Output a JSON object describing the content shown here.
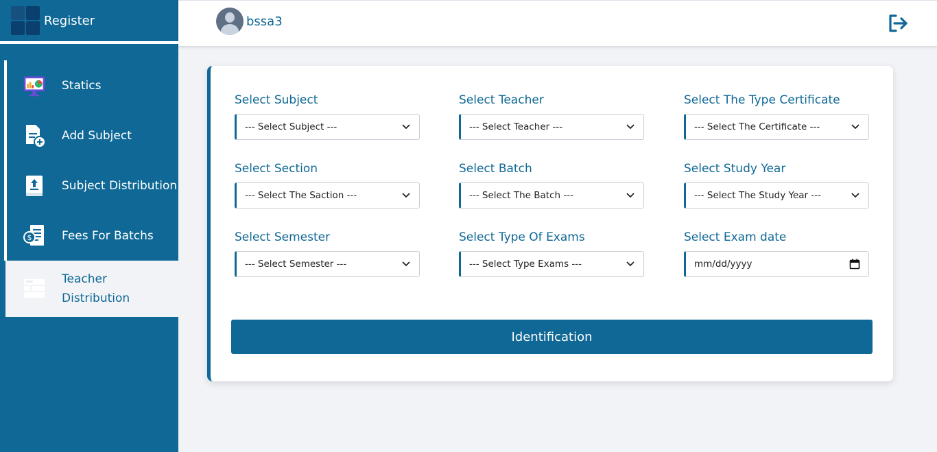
{
  "sidebar": {
    "brand": "Register",
    "items": [
      {
        "label": "Statics",
        "icon": "chart-monitor-icon"
      },
      {
        "label": "Add Subject",
        "icon": "add-document-icon"
      },
      {
        "label": "Subject Distribution",
        "icon": "upload-book-icon"
      },
      {
        "label": "Fees For Batchs",
        "icon": "fees-invoice-icon"
      },
      {
        "label": "Teacher Distribution",
        "icon": "distribution-grid-icon"
      }
    ],
    "active_index": 4
  },
  "header": {
    "username": "bssa3",
    "logout_icon": "logout-icon"
  },
  "form": {
    "subject": {
      "label": "Select Subject",
      "placeholder": "--- Select Subject ---"
    },
    "teacher": {
      "label": "Select Teacher",
      "placeholder": "--- Select Teacher ---"
    },
    "certificate": {
      "label": "Select The Type Certificate",
      "placeholder": "--- Select The Certificate ---"
    },
    "section": {
      "label": "Select Section",
      "placeholder": "--- Select The Saction ---"
    },
    "batch": {
      "label": "Select Batch",
      "placeholder": "--- Select The Batch ---"
    },
    "study_year": {
      "label": "Select Study Year",
      "placeholder": "--- Select The Study Year ---"
    },
    "semester": {
      "label": "Select Semester",
      "placeholder": "--- Select Semester ---"
    },
    "exam_type": {
      "label": "Select Type Of Exams",
      "placeholder": "--- Select Type Exams ---"
    },
    "exam_date": {
      "label": "Select Exam date",
      "placeholder": "mm/dd/yyyy"
    },
    "submit_label": "Identification"
  },
  "colors": {
    "primary": "#0f6895",
    "background": "#f1f3f7",
    "card": "#ffffff"
  }
}
